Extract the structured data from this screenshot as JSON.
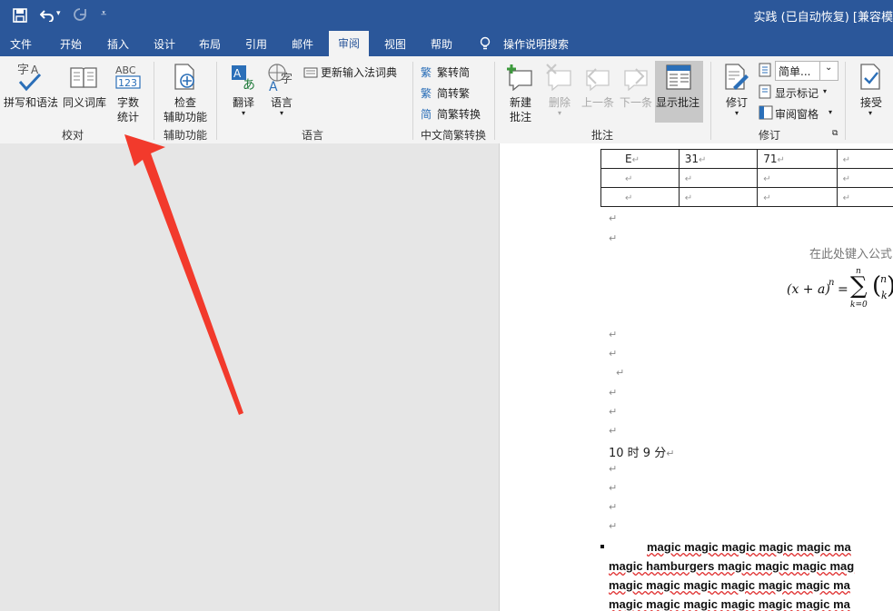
{
  "titlebar": {
    "doc_title": "实践 (已自动恢复) [兼容模",
    "save_icon": "save-icon",
    "undo_icon": "undo-icon",
    "redo_icon": "redo-icon",
    "customize_icon": "customize-qat-icon"
  },
  "tabs": [
    "文件",
    "开始",
    "插入",
    "设计",
    "布局",
    "引用",
    "邮件",
    "审阅",
    "视图",
    "帮助"
  ],
  "active_tab": "审阅",
  "tell_me": "操作说明搜索",
  "ribbon": {
    "proofing": {
      "spelling": "拼写和语法",
      "thesaurus": "同义词库",
      "word_count_1": "字数",
      "word_count_2": "统计",
      "label": "校对"
    },
    "accessibility": {
      "check_1": "检查",
      "check_2": "辅助功能",
      "label": "辅助功能"
    },
    "language": {
      "translate": "翻译",
      "language": "语言",
      "update_ime": "更新输入法词典",
      "label": "语言"
    },
    "chinese": {
      "t2s": "繁转简",
      "s2t": "简转繁",
      "convert": "简繁转换",
      "label": "中文简繁转换"
    },
    "comments": {
      "new_1": "新建",
      "new_2": "批注",
      "delete": "删除",
      "prev": "上一条",
      "next": "下一条",
      "show": "显示批注",
      "label": "批注"
    },
    "tracking": {
      "track": "修订",
      "markup_select": "简单...",
      "show_markup": "显示标记",
      "review_pane": "审阅窗格",
      "label": "修订"
    },
    "accept": {
      "label": "接受"
    }
  },
  "document": {
    "table_rows": [
      [
        "E",
        "31",
        "71",
        ""
      ],
      [
        "",
        "",
        "",
        ""
      ],
      [
        "",
        "",
        "",
        ""
      ]
    ],
    "formula_placeholder": "在此处键入公式",
    "formula_lhs": "(x + a)",
    "formula_exp": "n",
    "formula_sum_top": "n",
    "formula_sum_bottom": "k=0",
    "formula_binom_top": "n",
    "formula_binom_bottom": "k",
    "time_text": "10 时 9 分",
    "magic_lines": [
      "magic magic magic magic magic ma",
      "magic hamburgers magic magic magic mag",
      "magic magic magic magic magic magic ma",
      "magic magic magic magic magic magic ma"
    ],
    "para_mark": "↵"
  },
  "colors": {
    "ribbon_blue": "#2b579a",
    "arrow_red": "#f23a2c",
    "spell_red": "#e03030"
  }
}
